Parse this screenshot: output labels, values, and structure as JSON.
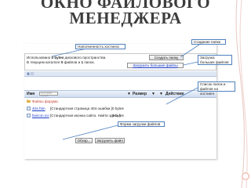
{
  "slide": {
    "title_line1": "ОКНО ФАЙЛОВОГО",
    "title_line2": "МЕНЕДЖЕРА"
  },
  "callouts": {
    "hosting_fill": "Наполненность хостинга",
    "create_folder": "Создание папки",
    "bulk_upload": "Загрузка больших файлов",
    "file_list": "Список папок и файлов на хостинге",
    "upload_form": "Форма загрузки файлов"
  },
  "manager": {
    "usage_line": {
      "prefix": "Использовано",
      "value": "0 bytes",
      "suffix": "дискового пространства."
    },
    "count_line": {
      "prefix": "В текущем каталоге",
      "files": "0",
      "middle": "файлов и",
      "folders": "1",
      "suffix": "папок."
    },
    "create_folder_button": "Создать папку",
    "bulk_upload_link": "Загрузить большие файлы",
    "columns": {
      "name": "Имя",
      "search_placeholder": "Быстрый поиск",
      "size": "Размер",
      "action": "Действие",
      "sort_arrow": "▼"
    },
    "folder_row": {
      "name": "Файлы форума"
    },
    "files": [
      {
        "name": "404.htm",
        "desc": "[Стандартная страница 404 ошибки ]",
        "size": "0 bytes"
      },
      {
        "name": "favicon.ico",
        "desc": "[Стандартная иконка сайта. Найти здесь ]",
        "size": "0 bytes"
      }
    ],
    "browse_button": "Обзор...",
    "upload_button": "Загрузить файл"
  },
  "colors": {
    "accent": "#4f81bd",
    "header_bg": "#cfdbef",
    "link": "#1a3cc9",
    "folder": "#c0392b"
  }
}
